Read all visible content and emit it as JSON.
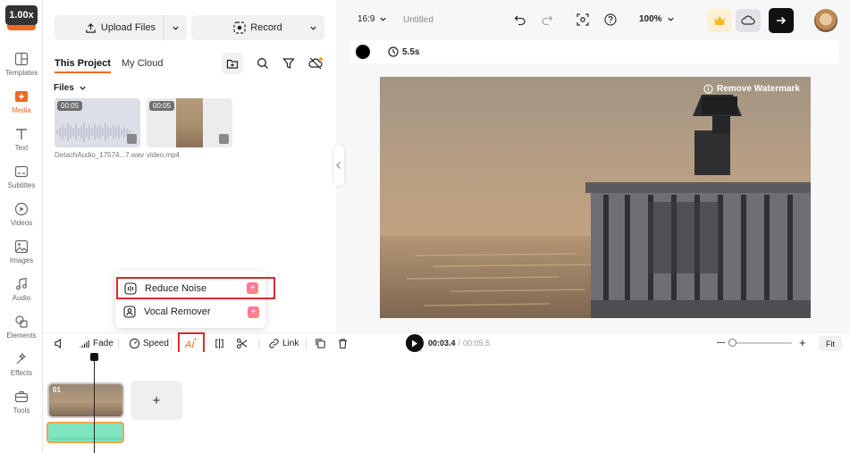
{
  "rail": {
    "speed": "1.00x",
    "items": [
      {
        "label": "Templates",
        "icon": "templates-icon"
      },
      {
        "label": "Media",
        "icon": "media-icon"
      },
      {
        "label": "Text",
        "icon": "text-icon"
      },
      {
        "label": "Subtitles",
        "icon": "subtitles-icon"
      },
      {
        "label": "Videos",
        "icon": "videos-icon"
      },
      {
        "label": "Images",
        "icon": "images-icon"
      },
      {
        "label": "Audio",
        "icon": "audio-icon"
      },
      {
        "label": "Elements",
        "icon": "elements-icon"
      },
      {
        "label": "Effects",
        "icon": "effects-icon"
      },
      {
        "label": "Tools",
        "icon": "tools-icon"
      }
    ]
  },
  "media": {
    "upload_label": "Upload Files",
    "record_label": "Record",
    "tab_project": "This Project",
    "tab_cloud": "My Cloud",
    "files_label": "Files",
    "files": [
      {
        "name": "DetachAudio_17574...7.wav",
        "duration": "00:05"
      },
      {
        "name": "video.mp4",
        "duration": "00:05"
      }
    ]
  },
  "ai_menu": {
    "items": [
      {
        "label": "Reduce Noise"
      },
      {
        "label": "Vocal Remover"
      }
    ]
  },
  "topbar": {
    "aspect": "16:9",
    "title": "Untitled",
    "zoom": "100%"
  },
  "subbar": {
    "duration": "5.5s"
  },
  "preview": {
    "watermark_label": "Remove Watermark"
  },
  "timeline_toolbar": {
    "fade_label": "Fade",
    "speed_label": "Speed",
    "link_label": "Link",
    "current_time": "00:03.4",
    "separator": "/",
    "total_time": "00:05.5",
    "fit_label": "Fit"
  },
  "timeline": {
    "clip_index": "01",
    "add_label": "+"
  },
  "colors": {
    "accent": "#f26a1b",
    "highlight_red": "#e0282e",
    "audio_track": "#7ee6bf"
  }
}
